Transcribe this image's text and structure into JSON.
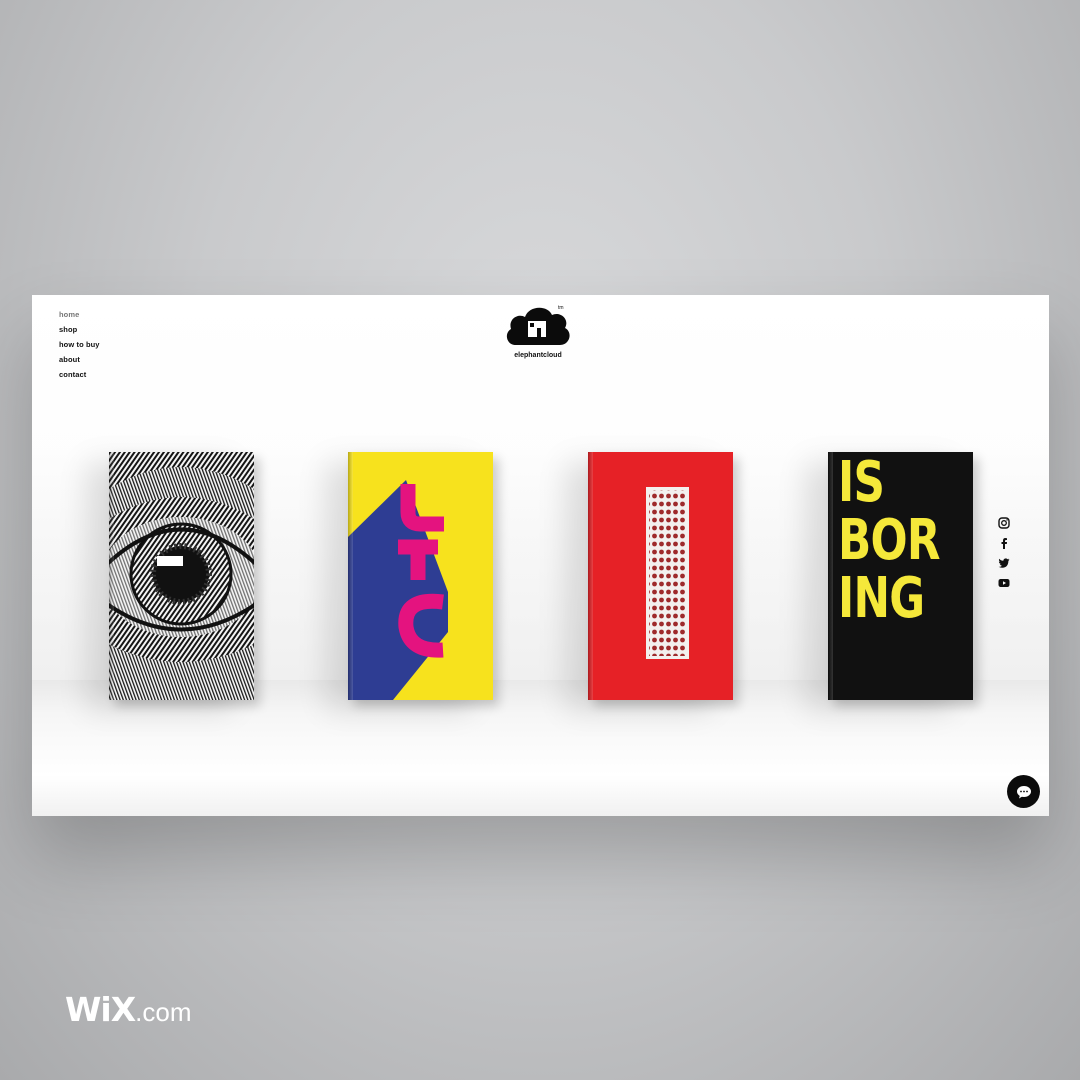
{
  "nav": {
    "items": [
      {
        "label": "home",
        "active": true
      },
      {
        "label": "shop"
      },
      {
        "label": "how to buy"
      },
      {
        "label": "about"
      },
      {
        "label": "contact"
      }
    ]
  },
  "brand": {
    "name": "elephantcloud",
    "tm": "tm"
  },
  "books": [
    {
      "cover": "eye engraving",
      "color": "#111111"
    },
    {
      "cover": "yellow-blue-magenta",
      "color": "#f7e21d"
    },
    {
      "cover": "red matchbox pattern",
      "color": "#e62126"
    },
    {
      "cover": "black with yellow type",
      "color": "#111111",
      "text": "IS\nBOR\nING"
    }
  ],
  "social": [
    "instagram-icon",
    "facebook-icon",
    "twitter-icon",
    "youtube-icon"
  ],
  "chat": {
    "icon": "chat-icon"
  },
  "watermark": {
    "brand": "WiX",
    "suffix": ".com"
  }
}
